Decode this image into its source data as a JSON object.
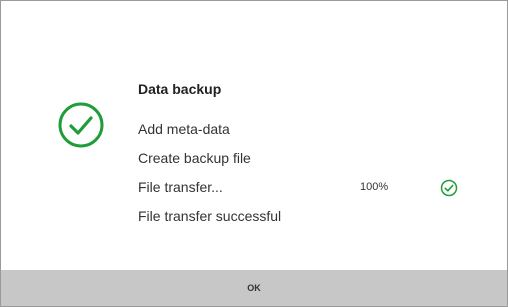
{
  "dialog": {
    "title": "Data backup",
    "status_icon": "check-circle-icon",
    "steps": [
      {
        "label": "Add meta-data"
      },
      {
        "label": "Create backup file"
      },
      {
        "label": "File transfer...",
        "progress_text": "100%",
        "progress_value": 1.0,
        "status_icon": "check-circle-icon"
      },
      {
        "label": "File transfer successful"
      }
    ],
    "ok_label": "OK"
  },
  "colors": {
    "success": "#1f9d3a",
    "footer_background": "#c7c7c7",
    "border": "#9a9a9a"
  }
}
